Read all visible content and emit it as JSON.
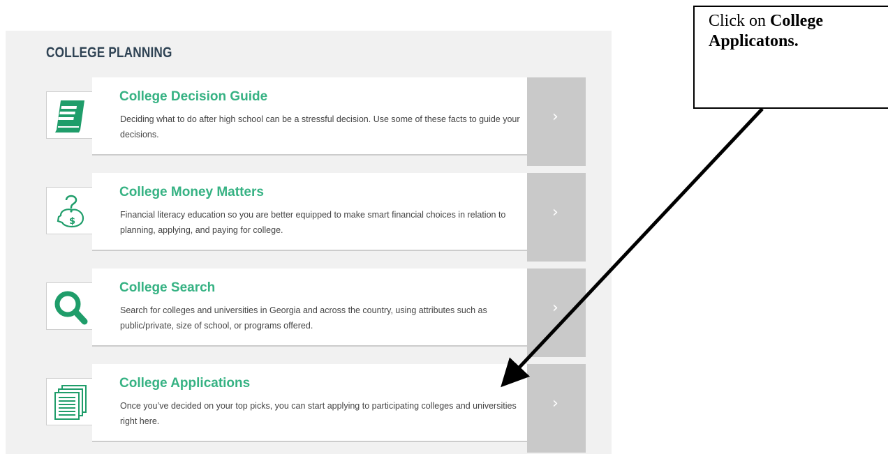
{
  "section": {
    "title": "COLLEGE PLANNING"
  },
  "cards": [
    {
      "title": "College Decision Guide",
      "description": "Deciding what to do after high school can be a stressful decision. Use some of these facts to guide your decisions.",
      "icon": "book-icon",
      "arrow": "›"
    },
    {
      "title": "College Money Matters",
      "description": "Financial literacy education so you are better equipped to make smart financial choices in relation to planning, applying, and paying for college.",
      "icon": "piggy-bank-question-icon",
      "arrow": "›"
    },
    {
      "title": "College Search",
      "description": "Search for colleges and universities in Georgia and across the country, using attributes such as public/private, size of school, or programs offered.",
      "icon": "magnifier-icon",
      "arrow": "›"
    },
    {
      "title": "College Applications",
      "description": "Once you’ve decided on your top picks, you can start applying to participating colleges and universities right here.",
      "icon": "documents-stack-icon",
      "arrow": "›"
    }
  ],
  "callout": {
    "prefix": "Click on ",
    "emphasis": "College Applicatons."
  },
  "colors": {
    "accent": "#36b283",
    "heading": "#2f4354",
    "panel": "#f1f1f1",
    "arrow_bg": "#c9c9c9"
  }
}
